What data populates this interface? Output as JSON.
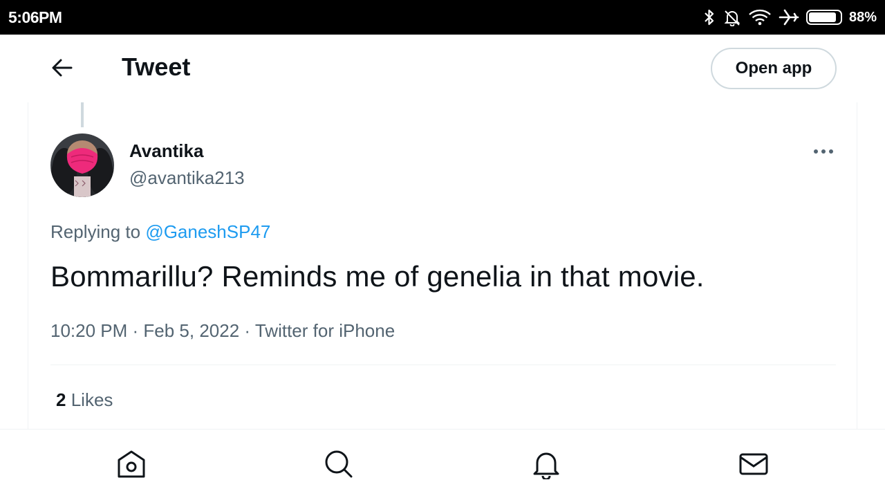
{
  "status_bar": {
    "time": "5:06PM",
    "battery": "88%",
    "battery_level": 0.88,
    "icons": [
      "bluetooth-icon",
      "notifications-off-icon",
      "wifi-icon",
      "airplane-mode-icon",
      "battery-icon"
    ]
  },
  "header": {
    "title": "Tweet",
    "open_app_label": "Open app",
    "back_icon": "arrow-left-icon"
  },
  "tweet": {
    "author": {
      "display_name": "Avantika",
      "handle": "@avantika213"
    },
    "replying_to_prefix": "Replying to",
    "replying_to_handle": "@GaneshSP47",
    "text": "Bommarillu? Reminds me of genelia in that movie.",
    "timestamp": "10:20 PM · Feb 5, 2022",
    "separator": "·",
    "source": "Twitter for iPhone",
    "likes_count": "2",
    "likes_label": "Likes"
  },
  "bottom_nav": {
    "items": [
      "home-icon",
      "search-icon",
      "notifications-icon",
      "messages-icon"
    ]
  },
  "colors": {
    "accent": "#1d9bf0",
    "text_primary": "#0f1419",
    "text_secondary": "#536471",
    "border": "#cfd9de"
  }
}
